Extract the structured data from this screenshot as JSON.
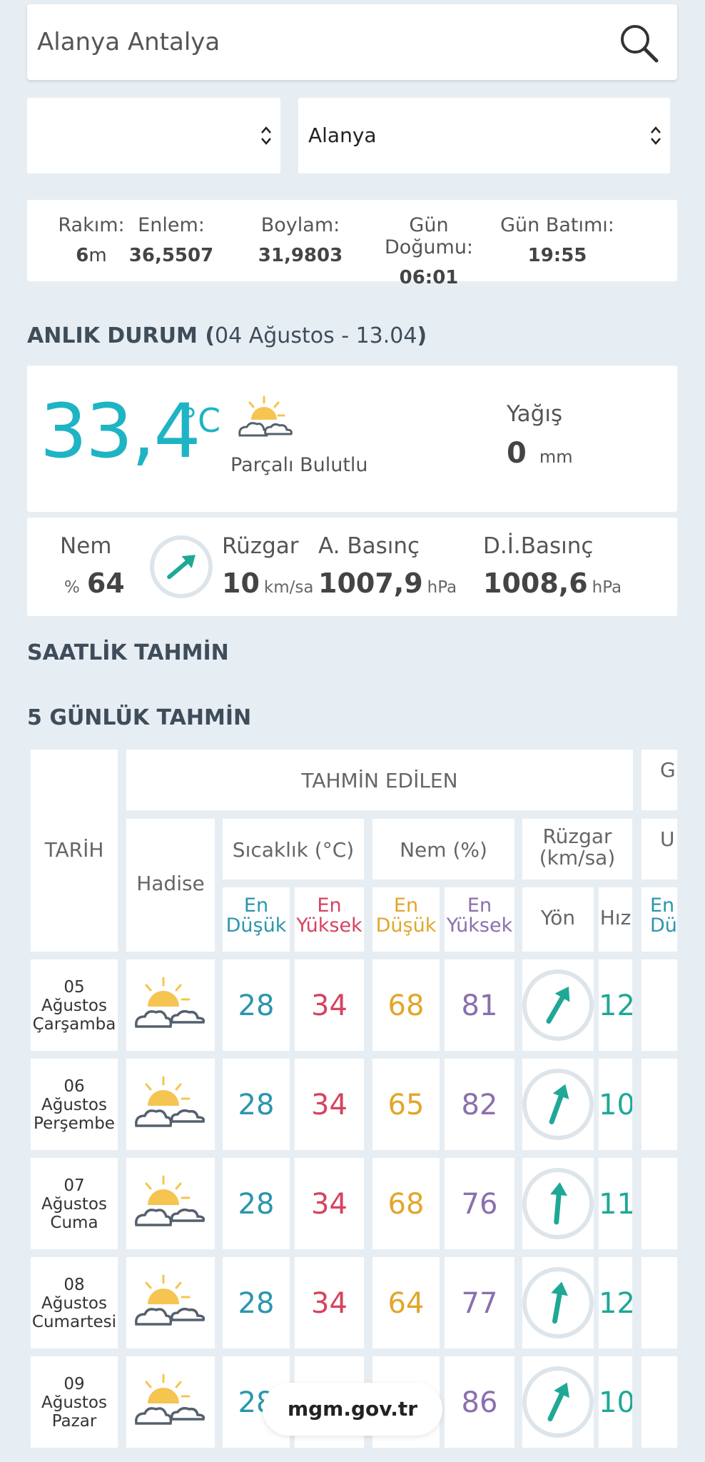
{
  "search": {
    "value": "Alanya Antalya"
  },
  "selects": {
    "district_left": "",
    "district_right": "Alanya"
  },
  "info": [
    {
      "label": "Rakım:",
      "value": "6",
      "unit": "m"
    },
    {
      "label": "Enlem:",
      "value": "36,5507"
    },
    {
      "label": "Boylam:",
      "value": "31,9803"
    },
    {
      "label": "Gün Doğumu:",
      "value": "06:01"
    },
    {
      "label": "Gün Batımı:",
      "value": "19:55"
    }
  ],
  "current": {
    "title": "ANLIK DURUM (",
    "title_date": "04 Ağustos - 13.04",
    "title_close": ")",
    "temperature": "33,4",
    "temp_unit": "°C",
    "condition": "Parçalı Bulutlu",
    "icon": "partly-cloudy-icon",
    "yagis_label": "Yağış",
    "yagis_value": "0",
    "yagis_unit": "mm",
    "nem_label": "Nem",
    "nem_prefix": "%",
    "nem_value": "64",
    "ruzgar_label": "Rüzgar",
    "ruzgar_value": "10",
    "ruzgar_unit": "km/sa",
    "abasinc_label": "A. Basınç",
    "abasinc_value": "1007,9",
    "abasinc_unit": "hPa",
    "dibasinc_label": "D.İ.Basınç",
    "dibasinc_value": "1008,6",
    "dibasinc_unit": "hPa"
  },
  "hourly_title": "SAATLİK TAHMİN",
  "forecast_title": "5 GÜNLÜK TAHMİN",
  "table": {
    "tarih": "TARİH",
    "tahmin": "TAHMİN EDİLEN",
    "next_group": "G",
    "hadise": "Hadise",
    "sicaklik": "Sıcaklık (°C)",
    "nem": "Nem (%)",
    "ruzgar": "Rüzgar (km/sa)",
    "next_col": "U",
    "en": "En",
    "dusuk": "Düşük",
    "yuksek": "Yüksek",
    "yon": "Yön",
    "hiz": "Hız",
    "dus_short": "Düş"
  },
  "days": [
    {
      "day": "05",
      "month": "Ağustos",
      "weekday": "Çarşamba",
      "tmin": "28",
      "tmax": "34",
      "hmin": "68",
      "hmax": "81",
      "wind_dir_deg": 30,
      "wind_speed": "12"
    },
    {
      "day": "06",
      "month": "Ağustos",
      "weekday": "Perşembe",
      "tmin": "28",
      "tmax": "34",
      "hmin": "65",
      "hmax": "82",
      "wind_dir_deg": 20,
      "wind_speed": "10"
    },
    {
      "day": "07",
      "month": "Ağustos",
      "weekday": "Cuma",
      "tmin": "28",
      "tmax": "34",
      "hmin": "68",
      "hmax": "76",
      "wind_dir_deg": 5,
      "wind_speed": "11"
    },
    {
      "day": "08",
      "month": "Ağustos",
      "weekday": "Cumartesi",
      "tmin": "28",
      "tmax": "34",
      "hmin": "64",
      "hmax": "77",
      "wind_dir_deg": 10,
      "wind_speed": "12"
    },
    {
      "day": "09",
      "month": "Ağustos",
      "weekday": "Pazar",
      "tmin": "28",
      "tmax": "",
      "hmin": "",
      "hmax": "86",
      "wind_dir_deg": 25,
      "wind_speed": "10"
    }
  ],
  "footer_pill": "mgm.gov.tr",
  "colors": {
    "temp": "#1eb4c4",
    "min": "#2a96ae",
    "max": "#d6435f",
    "hum_min": "#e2a62a",
    "hum_max": "#8a6fae",
    "wind": "#1fa896"
  }
}
